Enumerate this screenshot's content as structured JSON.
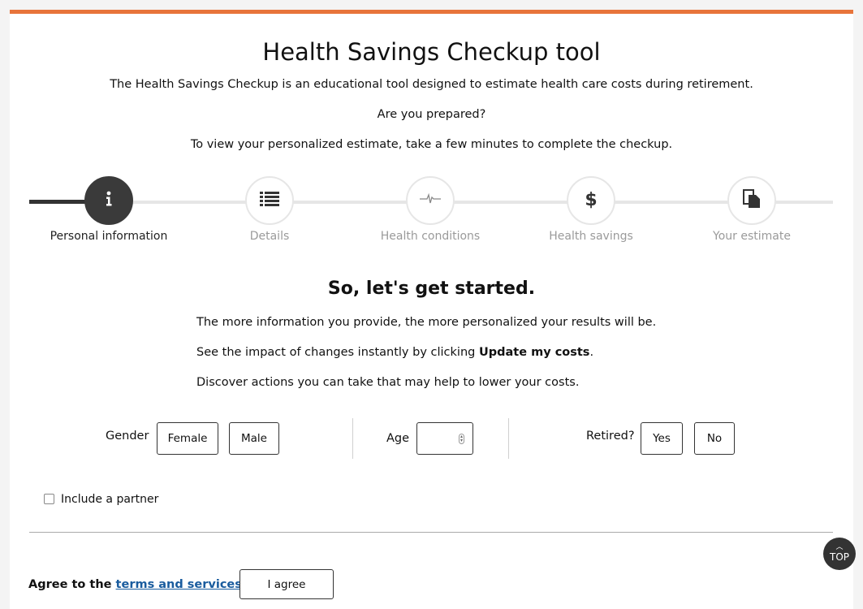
{
  "header": {
    "title": "Health Savings Checkup tool",
    "intro_line1": "The Health Savings Checkup is an educational tool designed to estimate health care costs during retirement.",
    "intro_line2": "Are you prepared?",
    "intro_line3": "To view your personalized estimate, take a few minutes to complete the checkup."
  },
  "steps": [
    {
      "label": "Personal information",
      "icon": "info-icon",
      "active": true
    },
    {
      "label": "Details",
      "icon": "list-icon",
      "active": false
    },
    {
      "label": "Health conditions",
      "icon": "heartbeat-icon",
      "active": false
    },
    {
      "label": "Health savings",
      "icon": "dollar-icon",
      "active": false
    },
    {
      "label": "Your estimate",
      "icon": "document-icon",
      "active": false
    }
  ],
  "main": {
    "heading": "So, let's get started.",
    "line1": "The more information you provide, the more personalized your results will be.",
    "line2_prefix": "See the impact of changes instantly by clicking ",
    "line2_bold": "Update my costs",
    "line2_suffix": ".",
    "line3": "Discover actions you can take that may help to lower your costs."
  },
  "form": {
    "gender_label": "Gender",
    "female": "Female",
    "male": "Male",
    "age_label": "Age",
    "age_value": "",
    "retired_label": "Retired?",
    "yes": "Yes",
    "no": "No",
    "partner_label": "Include a partner",
    "partner_checked": false
  },
  "footer": {
    "agree_prefix": "Agree to the ",
    "agree_link": "terms and services.",
    "agree_button": "I agree",
    "top_button": "TOP"
  },
  "colors": {
    "accent": "#e8743b",
    "step_active": "#3a3a3a",
    "link": "#1a5c9e"
  }
}
